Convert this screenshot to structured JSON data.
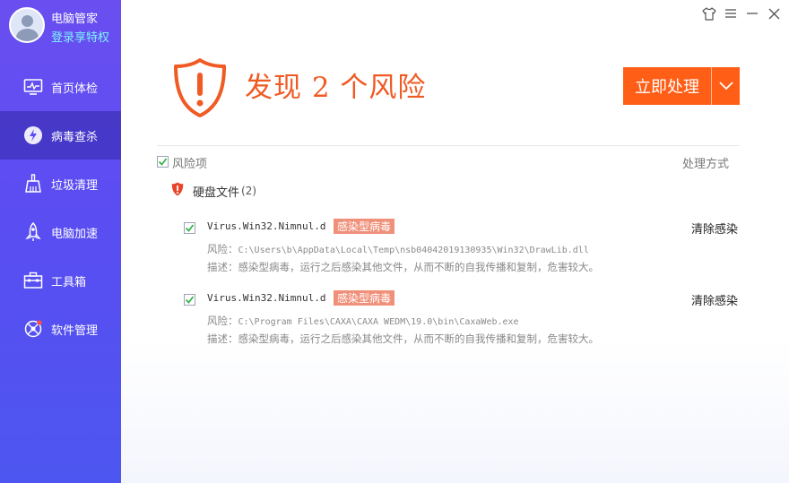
{
  "profile": {
    "name": "电脑管家",
    "vip_link": "登录享特权"
  },
  "nav": {
    "items": [
      {
        "label": "首页体检",
        "icon": "monitor-icon"
      },
      {
        "label": "病毒查杀",
        "icon": "lightning-shield-icon",
        "active": true
      },
      {
        "label": "垃圾清理",
        "icon": "broom-icon"
      },
      {
        "label": "电脑加速",
        "icon": "rocket-icon"
      },
      {
        "label": "工具箱",
        "icon": "toolbox-icon"
      },
      {
        "label": "软件管理",
        "icon": "app-manager-icon"
      }
    ]
  },
  "window_controls": [
    "skin-icon",
    "menu-icon",
    "minimize-icon",
    "close-icon"
  ],
  "result": {
    "headline": "发现 2 个风险",
    "action_button": "立即处理"
  },
  "table": {
    "col_risk": "风险项",
    "col_action": "处理方式",
    "group": {
      "label": "硬盘文件",
      "count": "(2)"
    },
    "items": [
      {
        "name": "Virus.Win32.Nimnul.d",
        "tag": "感染型病毒",
        "action": "清除感染",
        "path_label": "风险：",
        "path": "C:\\Users\\b\\AppData\\Local\\Temp\\nsb04042019130935\\Win32\\DrawLib.dll",
        "desc": "描述：感染型病毒，运行之后感染其他文件，从而不断的自我传播和复制，危害较大。"
      },
      {
        "name": "Virus.Win32.Nimnul.d",
        "tag": "感染型病毒",
        "action": "清除感染",
        "path_label": "风险：",
        "path": "C:\\Program Files\\CAXA\\CAXA WEDM\\19.0\\bin\\CaxaWeb.exe",
        "desc": "描述：感染型病毒，运行之后感染其他文件，从而不断的自我传播和复制，危害较大。"
      }
    ]
  },
  "colors": {
    "accent": "#ff5e17",
    "headline": "#f05a23",
    "sidebar_top": "#6a4ef0",
    "sidebar_bottom": "#4d56f0",
    "tag_bg": "#f0907a",
    "check": "#3bb34a"
  }
}
